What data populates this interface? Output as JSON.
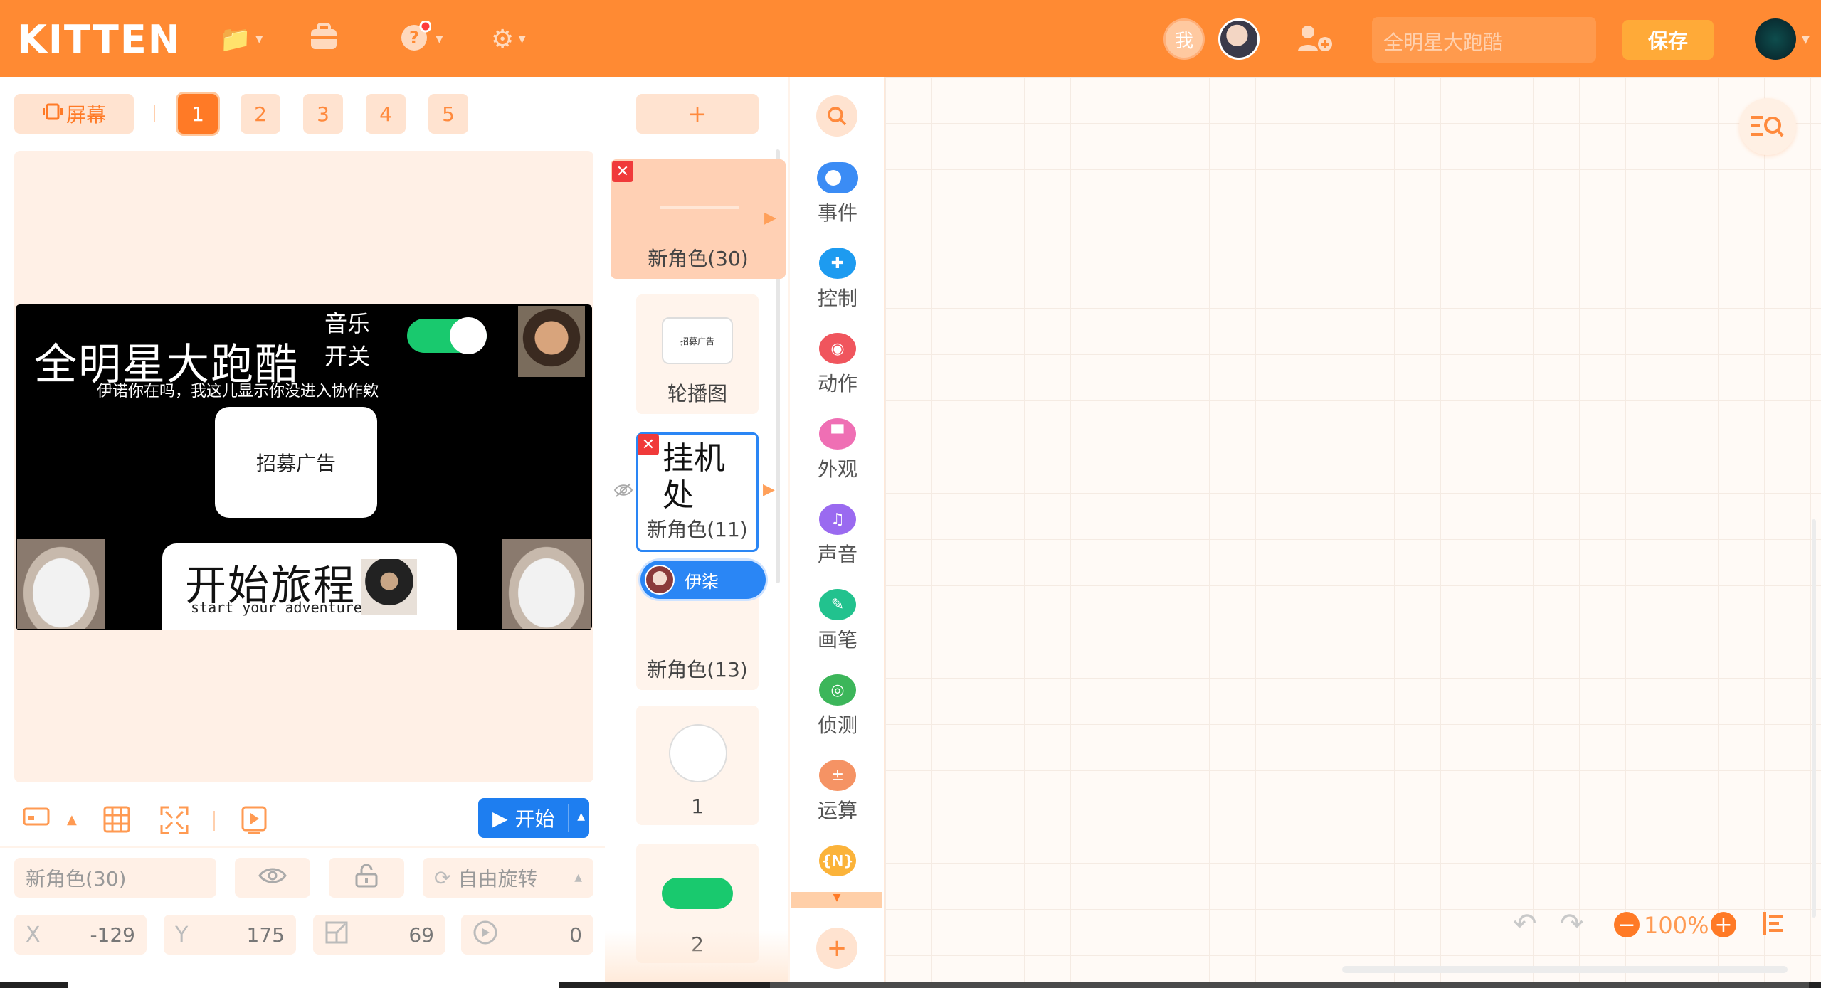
{
  "header": {
    "logo": "KITTEN",
    "me_badge": "我",
    "search_placeholder": "全明星大跑酷",
    "save_label": "保存",
    "icons": [
      "folder-icon",
      "bag-icon",
      "help-icon",
      "gear-icon"
    ]
  },
  "stage_panel": {
    "screen_button": "屏幕",
    "pages": [
      "1",
      "2",
      "3",
      "4",
      "5"
    ],
    "active_page": "1",
    "start_label": "开始"
  },
  "stage": {
    "title": "全明星大跑酷",
    "subtitle": "伊诺你在吗，我这儿显示你没进入协作欸",
    "music_line1": "音乐",
    "music_line2": "开关",
    "recruit": "招募广告",
    "start_big": "开始旅程",
    "start_small": "start your adventure"
  },
  "properties": {
    "sprite_name": "新角色(30)",
    "rotation_mode": "自由旋转",
    "x_label": "X",
    "x_value": "-129",
    "y_label": "Y",
    "y_value": "175",
    "size_value": "69",
    "direction_value": "0"
  },
  "sprites": {
    "add_label": "+",
    "items": [
      {
        "name": "新角色(30)"
      },
      {
        "name": "轮播图",
        "thumb": "招募广告"
      },
      {
        "name": "新角色(11)",
        "thumb": "挂机处"
      },
      {
        "name": "新角色(13)"
      },
      {
        "name": "1"
      },
      {
        "name": "2"
      }
    ],
    "collaborator": "伊柒"
  },
  "categories": [
    {
      "label": "事件",
      "color": "#3b8cf5"
    },
    {
      "label": "控制",
      "color": "#1d9bf0"
    },
    {
      "label": "动作",
      "color": "#f0555d"
    },
    {
      "label": "外观",
      "color": "#ef6fb4"
    },
    {
      "label": "声音",
      "color": "#9a6af0"
    },
    {
      "label": "画笔",
      "color": "#22c28e"
    },
    {
      "label": "侦测",
      "color": "#3cb65a"
    },
    {
      "label": "运算",
      "color": "#f59364"
    },
    {
      "label": "{N}",
      "color": "#fbb33a"
    }
  ],
  "workspace": {
    "zoom": "100%"
  },
  "colors": {
    "brand": "#ff8a33",
    "accent_blue": "#1e7ef0"
  }
}
